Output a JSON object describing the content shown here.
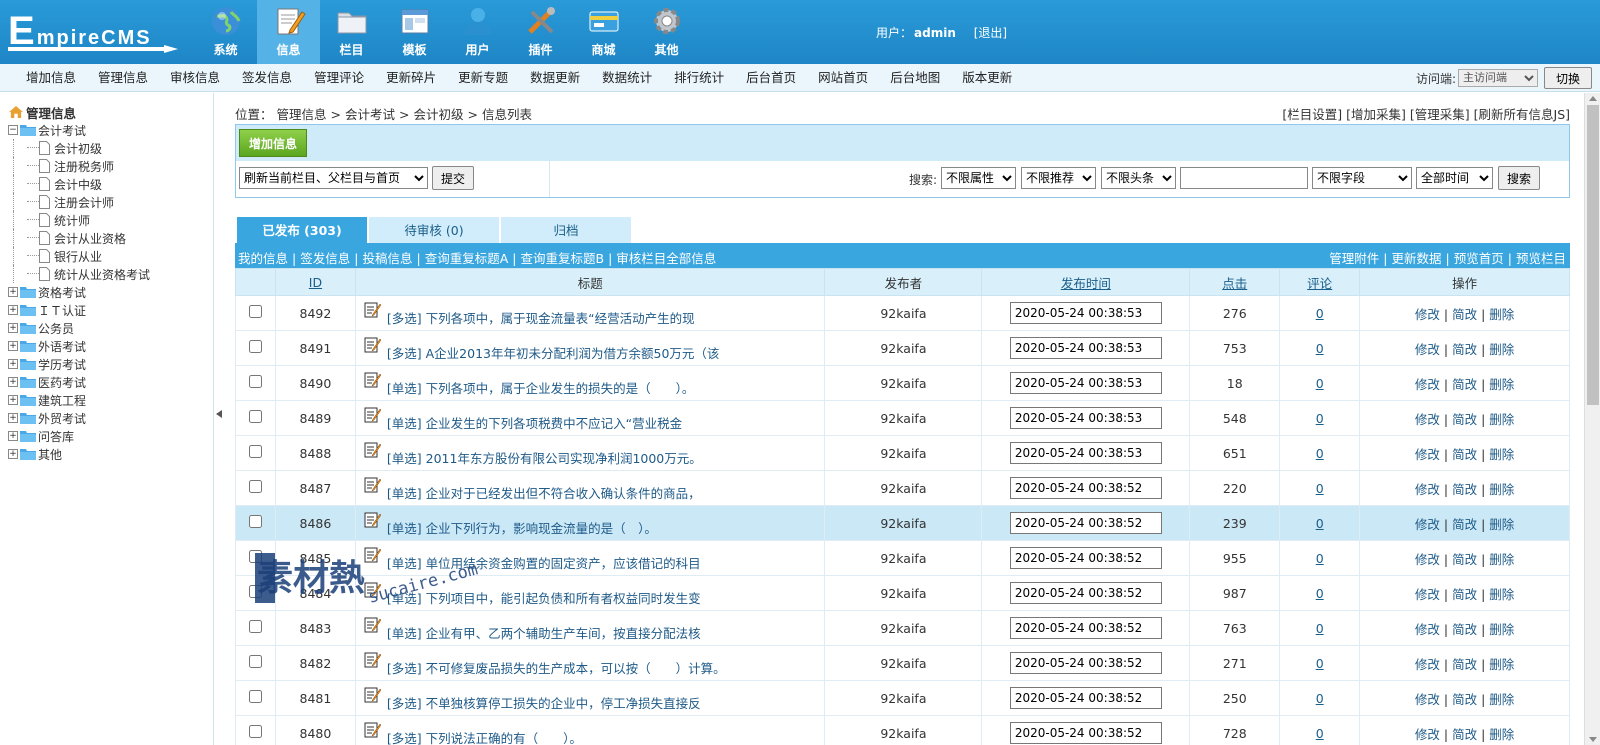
{
  "logo": {
    "text_big": "E",
    "text_rest": "mpireCMS"
  },
  "topnav": [
    {
      "label": "系统",
      "icon": "globe-icon"
    },
    {
      "label": "信息",
      "icon": "notepad-pencil-icon",
      "active": true
    },
    {
      "label": "栏目",
      "icon": "folder-icon"
    },
    {
      "label": "模板",
      "icon": "window-template-icon"
    },
    {
      "label": "用户",
      "icon": "user-icon"
    },
    {
      "label": "插件",
      "icon": "tools-icon"
    },
    {
      "label": "商城",
      "icon": "card-icon"
    },
    {
      "label": "其他",
      "icon": "gear-icon"
    }
  ],
  "user": {
    "label": "用户：",
    "name": "admin",
    "logout": "[退出]"
  },
  "subnav": [
    "增加信息",
    "管理信息",
    "审核信息",
    "签发信息",
    "管理评论",
    "更新碎片",
    "更新专题",
    "数据更新",
    "数据统计",
    "排行统计",
    "后台首页",
    "网站首页",
    "后台地图",
    "版本更新"
  ],
  "visit": {
    "label": "访问端:",
    "selected": "主访问端",
    "switch": "切换"
  },
  "sidebar": {
    "root": "管理信息",
    "expanded": {
      "label": "会计考试",
      "children": [
        "会计初级",
        "注册税务师",
        "会计中级",
        "注册会计师",
        "统计师",
        "会计从业资格",
        "银行从业",
        "统计从业资格考试"
      ]
    },
    "collapsed": [
      "资格考试",
      "ＩＴ认证",
      "公务员",
      "外语考试",
      "学历考试",
      "医药考试",
      "建筑工程",
      "外贸考试",
      "问答库",
      "其他"
    ]
  },
  "breadcrumb": {
    "label": "位置：",
    "items": [
      "管理信息",
      "会计考试",
      "会计初级",
      "信息列表"
    ],
    "sep": ">"
  },
  "rightlinks": [
    "[栏目设置]",
    "[增加采集]",
    "[管理采集]",
    "[刷新所有信息JS]"
  ],
  "toolbar": {
    "add_label": "增加信息",
    "refresh_selected": "刷新当前栏目、父栏目与首页",
    "submit_label": "提交"
  },
  "search": {
    "label": "搜索:",
    "attr": "不限属性",
    "recommend": "不限推荐",
    "headline": "不限头条",
    "keyword": "",
    "field": "不限字段",
    "time": "全部时间",
    "button": "搜索"
  },
  "tabs": [
    "已发布 (303)",
    "待审核 (0)",
    "归档"
  ],
  "listbar": {
    "left": [
      "我的信息",
      "签发信息",
      "投稿信息",
      "查询重复标题A",
      "查询重复标题B",
      "审核栏目全部信息"
    ],
    "right": [
      "管理附件",
      "更新数据",
      "预览首页",
      "预览栏目"
    ]
  },
  "table": {
    "headers": {
      "id": "ID",
      "title": "标题",
      "publisher": "发布者",
      "time": "发布时间",
      "hits": "点击",
      "comments": "评论",
      "ops": "操作"
    },
    "op_labels": [
      "修改",
      "简改",
      "删除"
    ],
    "rows": [
      {
        "id": "8492",
        "title": "[多选] 下列各项中，属于现金流量表“经营活动产生的现",
        "publisher": "92kaifa",
        "time": "2020-05-24 00:38:53",
        "hits": "276",
        "comments": "0"
      },
      {
        "id": "8491",
        "title": "[多选] A企业2013年年初未分配利润为借方余额50万元（该",
        "publisher": "92kaifa",
        "time": "2020-05-24 00:38:53",
        "hits": "753",
        "comments": "0"
      },
      {
        "id": "8490",
        "title": "[单选] 下列各项中，属于企业发生的损失的是（　　）。",
        "publisher": "92kaifa",
        "time": "2020-05-24 00:38:53",
        "hits": "18",
        "comments": "0"
      },
      {
        "id": "8489",
        "title": "[单选] 企业发生的下列各项税费中不应记入“营业税金",
        "publisher": "92kaifa",
        "time": "2020-05-24 00:38:53",
        "hits": "548",
        "comments": "0"
      },
      {
        "id": "8488",
        "title": "[单选] 2011年东方股份有限公司实现净利润1000万元。",
        "publisher": "92kaifa",
        "time": "2020-05-24 00:38:53",
        "hits": "651",
        "comments": "0"
      },
      {
        "id": "8487",
        "title": "[单选] 企业对于已经发出但不符合收入确认条件的商品，",
        "publisher": "92kaifa",
        "time": "2020-05-24 00:38:52",
        "hits": "220",
        "comments": "0"
      },
      {
        "id": "8486",
        "title": "[单选] 企业下列行为，影响现金流量的是（　）。",
        "publisher": "92kaifa",
        "time": "2020-05-24 00:38:52",
        "hits": "239",
        "comments": "0",
        "highlight": true
      },
      {
        "id": "8485",
        "title": "[单选] 单位用结余资金购置的固定资产，应该借记的科目",
        "publisher": "92kaifa",
        "time": "2020-05-24 00:38:52",
        "hits": "955",
        "comments": "0"
      },
      {
        "id": "8484",
        "title": "[单选] 下列项目中，能引起负债和所有者权益同时发生变",
        "publisher": "92kaifa",
        "time": "2020-05-24 00:38:52",
        "hits": "987",
        "comments": "0"
      },
      {
        "id": "8483",
        "title": "[单选] 企业有甲、乙两个辅助生产车间，按直接分配法核",
        "publisher": "92kaifa",
        "time": "2020-05-24 00:38:52",
        "hits": "763",
        "comments": "0"
      },
      {
        "id": "8482",
        "title": "[多选] 不可修复废品损失的生产成本，可以按（　　）计算。",
        "publisher": "92kaifa",
        "time": "2020-05-24 00:38:52",
        "hits": "271",
        "comments": "0"
      },
      {
        "id": "8481",
        "title": "[多选] 不单独核算停工损失的企业中，停工净损失直接反",
        "publisher": "92kaifa",
        "time": "2020-05-24 00:38:52",
        "hits": "250",
        "comments": "0"
      },
      {
        "id": "8480",
        "title": "[多选] 下列说法正确的有（　　）。",
        "publisher": "92kaifa",
        "time": "2020-05-24 00:38:52",
        "hits": "728",
        "comments": "0"
      }
    ]
  },
  "watermark": {
    "text_cn": "素材熱",
    "text_en": "sucaire.com"
  },
  "colors": {
    "header": "#1e86c6",
    "accent": "#3aa6df",
    "add_button": "#5ca61f",
    "link": "#1e5a88"
  }
}
